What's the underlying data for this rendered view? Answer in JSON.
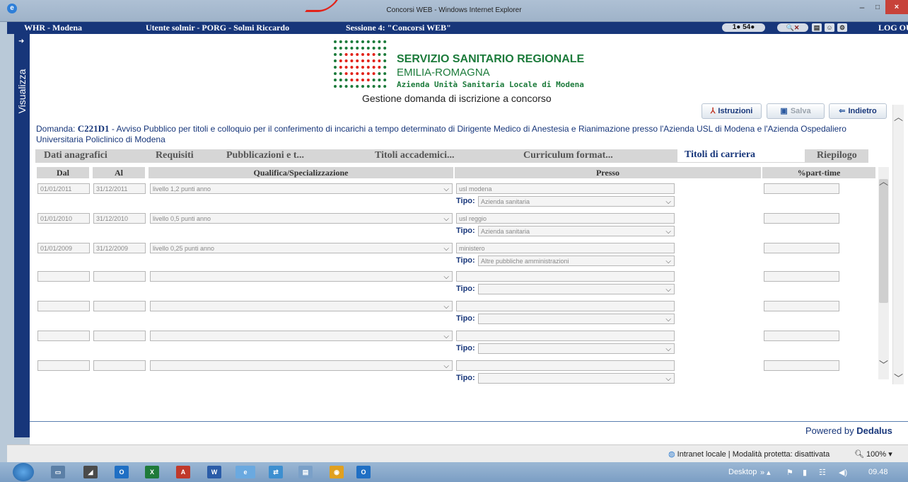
{
  "window": {
    "title": "Concorsi WEB - Windows Internet Explorer",
    "min": "–",
    "max": "□",
    "close": "×"
  },
  "appbar": {
    "app": "WHR - Modena",
    "user": "Utente solmir - PORG - Solmi Riccardo",
    "session": "Sessione 4: \"Concorsi WEB\"",
    "counters": "1● 54●",
    "search": "🔍✕",
    "logout": "LOG OUT"
  },
  "sidebar": {
    "label": "Visualizza",
    "arrow": "➜"
  },
  "org": {
    "line1": "SERVIZIO SANITARIO REGIONALE",
    "line2": "EMILIA-ROMAGNA",
    "line3": "Azienda Unità Sanitaria Locale di Modena",
    "subtitle": "Gestione domanda di iscrizione a concorso"
  },
  "toolbar": {
    "istruzioni": "Istruzioni",
    "salva": "Salva",
    "indietro": "Indietro"
  },
  "domanda": {
    "prefix": "Domanda: ",
    "code": "C221D1",
    "text": " - Avviso Pubblico per titoli e colloquio per il conferimento di incarichi a tempo determinato di Dirigente Medico di Anestesia e Rianimazione presso l'Azienda USL di Modena e l'Azienda Ospedaliero Universitaria Policlinico di Modena"
  },
  "tabs": [
    "Dati anagrafici",
    "Requisiti",
    "Pubblicazioni e t...",
    "Titoli accademici...",
    "Curriculum format...",
    "Titoli di carriera",
    "Riepilogo"
  ],
  "active_tab": "Titoli di carriera",
  "table": {
    "headers": [
      "Dal",
      "Al",
      "Qualifica/Specializzazione",
      "Presso",
      "%part-time"
    ],
    "tipo_label": "Tipo:",
    "rows": [
      {
        "dal": "01/01/2011",
        "al": "31/12/2011",
        "qualifica": "livello 1,2 punti anno",
        "presso": "usl modena",
        "tipo": "Azienda sanitaria",
        "parttime": ""
      },
      {
        "dal": "01/01/2010",
        "al": "31/12/2010",
        "qualifica": "livello 0,5 punti anno",
        "presso": "usl reggio",
        "tipo": "Azienda sanitaria",
        "parttime": ""
      },
      {
        "dal": "01/01/2009",
        "al": "31/12/2009",
        "qualifica": "livello 0,25 punti anno",
        "presso": "ministero",
        "tipo": "Altre pubbliche amministrazioni",
        "parttime": ""
      },
      {
        "dal": "",
        "al": "",
        "qualifica": "",
        "presso": "",
        "tipo": "",
        "parttime": ""
      },
      {
        "dal": "",
        "al": "",
        "qualifica": "",
        "presso": "",
        "tipo": "",
        "parttime": ""
      },
      {
        "dal": "",
        "al": "",
        "qualifica": "",
        "presso": "",
        "tipo": "",
        "parttime": ""
      },
      {
        "dal": "",
        "al": "",
        "qualifica": "",
        "presso": "",
        "tipo": "",
        "parttime": ""
      }
    ]
  },
  "footer": {
    "powered": "Powered by ",
    "brand": "Dedalus"
  },
  "status": {
    "text": "Intranet locale | Modalità protetta: disattivata",
    "zoom": "100%"
  },
  "taskbar": {
    "desktop": "Desktop",
    "time": "09.48"
  },
  "colors": {
    "navy": "#17367a",
    "green": "#1c7b3b",
    "red": "#e2231a"
  }
}
